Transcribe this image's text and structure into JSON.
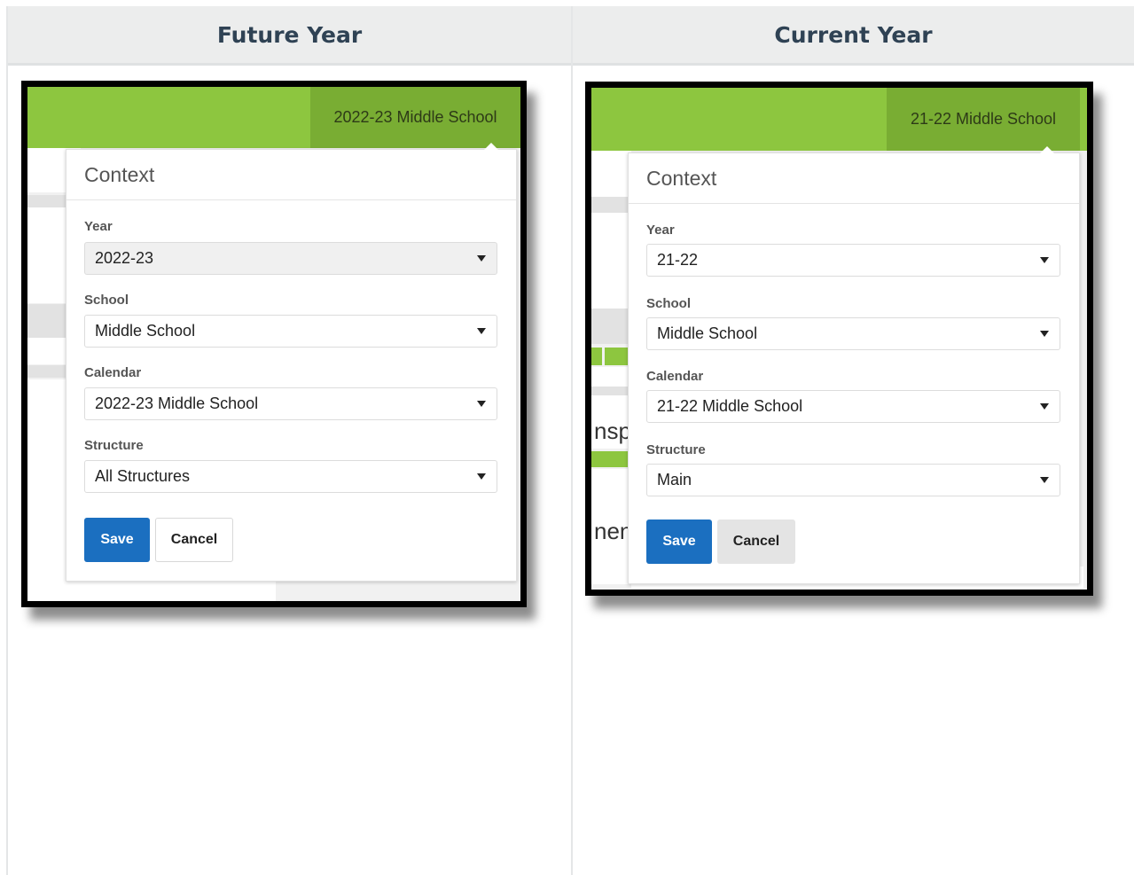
{
  "columns": [
    {
      "header": "Future Year"
    },
    {
      "header": "Current Year"
    }
  ],
  "panels": [
    {
      "calendar_button": "2022-23 Middle School",
      "title": "Context",
      "fields": [
        {
          "label": "Year",
          "value": "2022-23"
        },
        {
          "label": "School",
          "value": "Middle School"
        },
        {
          "label": "Calendar",
          "value": "2022-23 Middle School"
        },
        {
          "label": "Structure",
          "value": "All Structures"
        }
      ],
      "save": "Save",
      "cancel": "Cancel"
    },
    {
      "calendar_button": "21-22 Middle School",
      "title": "Context",
      "fields": [
        {
          "label": "Year",
          "value": "21-22"
        },
        {
          "label": "School",
          "value": "Middle School"
        },
        {
          "label": "Calendar",
          "value": "21-22 Middle School"
        },
        {
          "label": "Structure",
          "value": "Main"
        }
      ],
      "save": "Save",
      "cancel": "Cancel",
      "background_text": [
        "nspc",
        "nen"
      ]
    }
  ],
  "colors": {
    "header_bar": "#8dc63f",
    "calendar_button_bg": "#79ad33",
    "save_button": "#1b6fc0",
    "header_text": "#2f4254"
  },
  "icons": {
    "dropdown": "caret-down-icon"
  }
}
